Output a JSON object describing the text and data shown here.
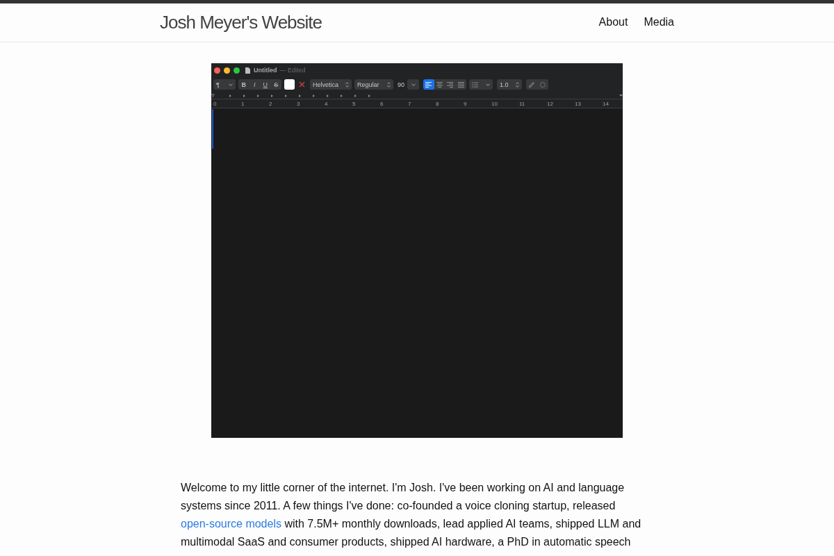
{
  "header": {
    "site_title": "Josh Meyer's Website",
    "nav": [
      {
        "label": "About"
      },
      {
        "label": "Media"
      }
    ]
  },
  "editor_window": {
    "title": "Untitled",
    "status": "— Edited",
    "toolbar": {
      "paragraph_menu": "¶",
      "style_buttons": [
        "B",
        "I",
        "U",
        "S"
      ],
      "font_family": "Helvetica",
      "font_style": "Regular",
      "font_size": "90",
      "alignment": [
        {
          "selected": true
        },
        {
          "selected": false
        },
        {
          "selected": false
        },
        {
          "selected": false
        }
      ],
      "line_spacing": "1.0"
    },
    "ruler": [
      "0",
      "1",
      "2",
      "3",
      "4",
      "5",
      "6",
      "7",
      "8",
      "9",
      "10",
      "11",
      "12",
      "13",
      "14"
    ]
  },
  "intro": [
    {
      "kind": "text",
      "text": "Welcome to my little corner of the internet. I'm Josh. I've been working on AI and language systems since 2011. A few things I've done: co-founded a voice cloning startup, released"
    },
    {
      "kind": "link",
      "text": "open-source models"
    },
    {
      "kind": "text",
      "text": "with 7.5M+ monthly downloads, lead applied AI teams, shipped LLM and multimodal SaaS and consumer products, shipped AI hardware, a PhD in automatic speech"
    }
  ]
}
